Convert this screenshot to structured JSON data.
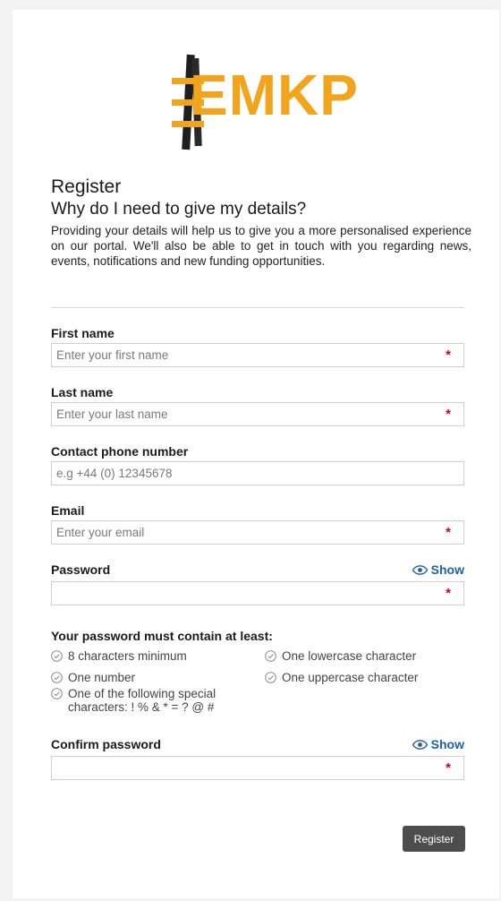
{
  "logo": {
    "text": "EMKP",
    "brand_color": "#f2a41d"
  },
  "intro": {
    "title": "Register",
    "subtitle": "Why do I need to give my details?",
    "description": "Providing your details will help us to give you a more personalised experience on our portal. We'll also be able to get in touch with you regarding news, events, notifications and new funding opportunities."
  },
  "form": {
    "first_name": {
      "label": "First name",
      "placeholder": "Enter your first name",
      "value": "",
      "required_mark": "*"
    },
    "last_name": {
      "label": "Last name",
      "placeholder": "Enter your last name",
      "value": "",
      "required_mark": "*"
    },
    "phone": {
      "label": "Contact phone number",
      "placeholder": "e.g +44 (0) 12345678",
      "value": ""
    },
    "email": {
      "label": "Email",
      "placeholder": "Enter your email",
      "value": "",
      "required_mark": "*"
    },
    "password": {
      "label": "Password",
      "show_label": "Show",
      "value": "",
      "required_mark": "*",
      "show_icon": "eye-icon"
    },
    "password_rules": {
      "heading": "Your password must contain at least:",
      "icon": "check-circle-icon",
      "items": [
        "8 characters minimum",
        "One lowercase character",
        "One number",
        "One uppercase character",
        "One of the following special characters: ! % & * = ? @ #"
      ]
    },
    "confirm_password": {
      "label": "Confirm password",
      "show_label": "Show",
      "value": "",
      "required_mark": "*",
      "show_icon": "eye-icon"
    },
    "submit_label": "Register"
  },
  "colors": {
    "required": "#d0021b",
    "link": "#1f5fa6",
    "button_bg": "#4d4d4d"
  }
}
